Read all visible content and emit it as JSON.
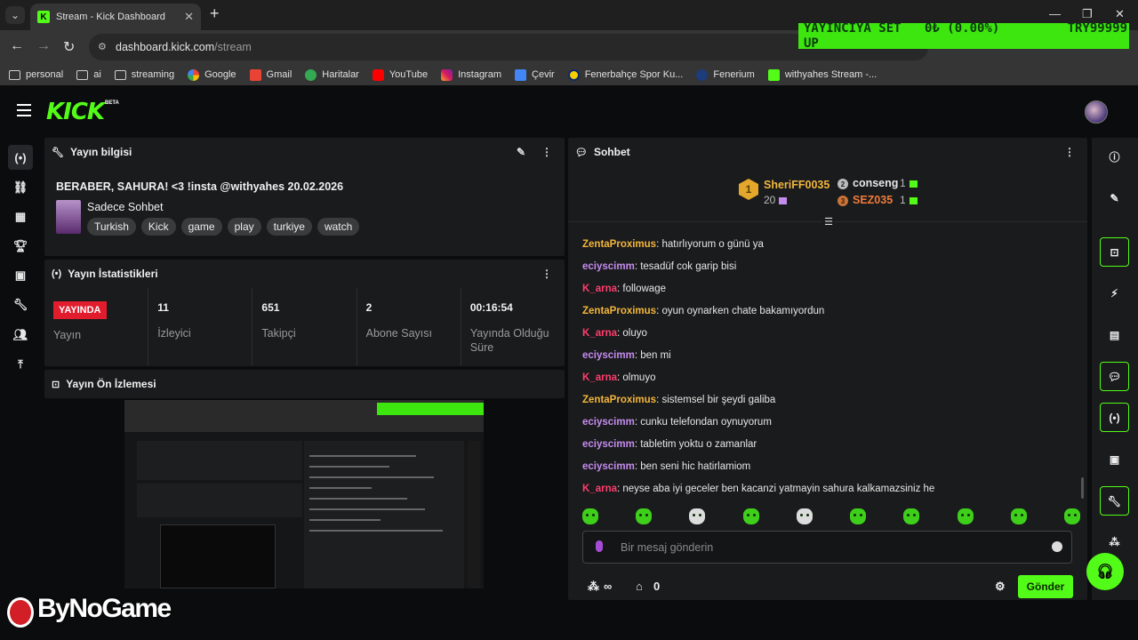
{
  "browser": {
    "tab_title": "Stream - Kick Dashboard",
    "url_domain": "dashboard.kick.com",
    "url_path": "/stream",
    "bookmarks": [
      "personal",
      "ai",
      "streaming",
      "Google",
      "Gmail",
      "Haritalar",
      "YouTube",
      "Instagram",
      "Çevir",
      "Fenerbahçe Spor Ku...",
      "Fenerium",
      "withyahes Stream -..."
    ]
  },
  "overlay": {
    "left": "YAYINCIYA SET UP",
    "middle": "0₺ (0.00%)",
    "right": "TRY99999"
  },
  "app": {
    "logo": "KICK",
    "beta": "BETA"
  },
  "stream_info": {
    "header": "Yayın bilgisi",
    "title": "BERABER, SAHURA! <3 !insta @withyahes 20.02.2026",
    "category": "Sadece Sohbet",
    "tags": [
      "Turkish",
      "Kick",
      "game",
      "play",
      "turkiye",
      "watch"
    ]
  },
  "stats": {
    "header": "Yayın İstatistikleri",
    "live_badge": "YAYINDA",
    "items": [
      {
        "value": "",
        "label": "Yayın"
      },
      {
        "value": "11",
        "label": "İzleyici"
      },
      {
        "value": "651",
        "label": "Takipçi"
      },
      {
        "value": "2",
        "label": "Abone Sayısı"
      },
      {
        "value": "00:16:54",
        "label": "Yayında Olduğu Süre"
      }
    ]
  },
  "preview": {
    "header": "Yayın Ön İzlemesi"
  },
  "chat": {
    "header": "Sohbet",
    "top_gifters": [
      {
        "rank": "1",
        "name": "SheriFF0035",
        "count": "20"
      },
      {
        "rank": "2",
        "name": "conseng",
        "count": "1"
      },
      {
        "rank": "3",
        "name": "SEZ035",
        "count": "1"
      }
    ],
    "messages": [
      {
        "user": "ZentaProximus",
        "color": "#f3b63c",
        "text": "hatırlıyorum o günü ya"
      },
      {
        "user": "eciyscimm",
        "color": "#c58cf0",
        "text": "tesadüf cok garip bisi"
      },
      {
        "user": "K_arna",
        "color": "#ff3d6e",
        "text": "followage"
      },
      {
        "user": "ZentaProximus",
        "color": "#f3b63c",
        "text": "oyun oynarken chate bakamıyordun"
      },
      {
        "user": "K_arna",
        "color": "#ff3d6e",
        "text": "oluyo"
      },
      {
        "user": "eciyscimm",
        "color": "#c58cf0",
        "text": "ben mi"
      },
      {
        "user": "K_arna",
        "color": "#ff3d6e",
        "text": "olmuyo"
      },
      {
        "user": "ZentaProximus",
        "color": "#f3b63c",
        "text": "sistemsel bir şeydi galiba"
      },
      {
        "user": "eciyscimm",
        "color": "#c58cf0",
        "text": "cunku telefondan oynuyorum"
      },
      {
        "user": "eciyscimm",
        "color": "#c58cf0",
        "text": "tabletim yoktu o zamanlar"
      },
      {
        "user": "eciyscimm",
        "color": "#c58cf0",
        "text": "ben seni hic hatirlamiom"
      },
      {
        "user": "K_arna",
        "color": "#ff3d6e",
        "text": "neyse aba iyi geceler ben kacanzi yatmayin sahura kalkamazsiniz he"
      }
    ],
    "input_placeholder": "Bir mesaj gönderin",
    "points": "∞",
    "store_count": "0",
    "send_label": "Gönder"
  },
  "watermark": "ByNoGame",
  "colors": {
    "accent": "#53fc18",
    "live": "#e11d2d"
  }
}
